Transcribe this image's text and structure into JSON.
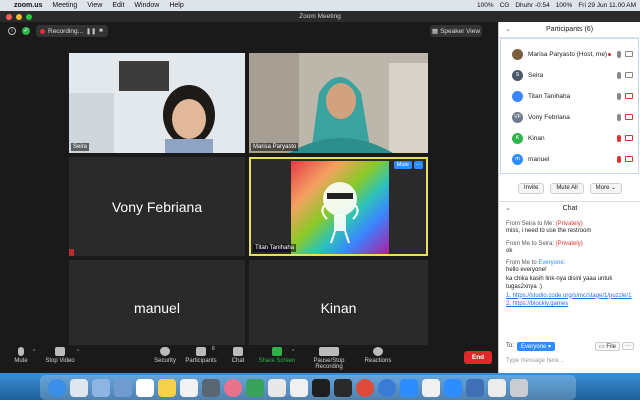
{
  "menubar": {
    "app": "zoom.us",
    "items": [
      "Meeting",
      "View",
      "Edit",
      "Window",
      "Help"
    ],
    "status": [
      "100%",
      "CG",
      "Dhuhr -0:54",
      "100%",
      "Fri 29 Jun  11.00 AM"
    ]
  },
  "window": {
    "title": "Zoom Meeting"
  },
  "top": {
    "recording_label": "Recording...",
    "pause": "❚❚",
    "stop": "■",
    "speaker_view": "Speaker View"
  },
  "tiles": {
    "seira": "Seira",
    "marisa": "Marisa Paryasto",
    "vony": "Vony Febriana",
    "titan": "Titan Tanihaha",
    "titan_mute": "Mute",
    "titan_more": "···",
    "manuel": "manuel",
    "kinan": "Kinan"
  },
  "toolbar": {
    "mute": "Mute",
    "stop_video": "Stop Video",
    "security": "Security",
    "participants": "Participants",
    "participants_count": "6",
    "chat": "Chat",
    "share": "Share Screen",
    "pause_rec": "Pause/Stop Recording",
    "reactions": "Reactions",
    "end": "End"
  },
  "participants_panel": {
    "title": "Participants (6)",
    "rows": [
      {
        "initials": "",
        "name": "Marisa Paryasto (Host, me)",
        "color": "#7a5c3e",
        "mic": "on",
        "cam": "on",
        "rec": true
      },
      {
        "initials": "S",
        "name": "Seira",
        "color": "#4a5a6a",
        "mic": "on",
        "cam": "on",
        "rec": false
      },
      {
        "initials": "",
        "name": "Titan Tanihaha",
        "color": "#3a86ff",
        "mic": "on",
        "cam": "off",
        "rec": false
      },
      {
        "initials": "VF",
        "name": "Vony Febriana",
        "color": "#6b7b8c",
        "mic": "on",
        "cam": "off",
        "rec": false
      },
      {
        "initials": "K",
        "name": "Kinan",
        "color": "#2fb34a",
        "mic": "off",
        "cam": "off",
        "rec": false
      },
      {
        "initials": "m",
        "name": "manuel",
        "color": "#2d8cff",
        "mic": "off",
        "cam": "off",
        "rec": false
      }
    ],
    "invite": "Invite",
    "mute_all": "Mute All",
    "more": "More"
  },
  "chat": {
    "title": "Chat",
    "messages": [
      {
        "from": "From Seira to Me:",
        "tag": "(Privately)",
        "text": "miss, i need to use the restroom"
      },
      {
        "from": "From Me to Seira:",
        "tag": "(Privately)",
        "text": "ok"
      }
    ],
    "last": {
      "from_prefix": "From Me to ",
      "to": "Everyone",
      "suffix": ":",
      "line1": "hello everyone!",
      "line2": "ka chika kasih link-nya disini yaaa untuk",
      "line3": "tugas2xnya :)",
      "link1": "1. https://studio.code.org/s/mc/stage/1/puzzle/1",
      "link2": "2. https://blockly.games"
    },
    "to_label": "To:",
    "to_value": "Everyone",
    "file": "File",
    "more": "···",
    "placeholder": "Type message here..."
  }
}
